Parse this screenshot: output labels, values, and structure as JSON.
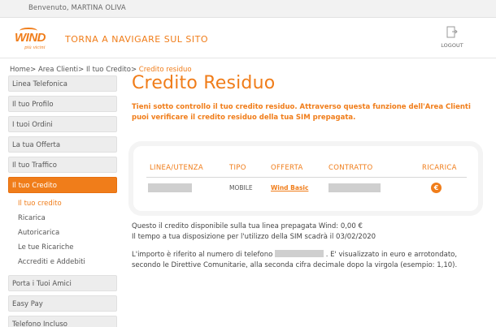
{
  "topbar": {
    "welcome": "Benvenuto, MARTINA OLIVA"
  },
  "header": {
    "logo_text": "WIND",
    "logo_tagline": "più vicini",
    "back_link": "TORNA A NAVIGARE SUL SITO",
    "logout_label": "LOGOUT"
  },
  "breadcrumb": {
    "home": "Home",
    "area": "Area Clienti",
    "credito": "Il tuo Credito",
    "current": "Credito residuo",
    "separator": ">"
  },
  "sidebar": {
    "items": [
      {
        "label": "Linea Telefonica"
      },
      {
        "label": "Il tuo Profilo"
      },
      {
        "label": "I tuoi Ordini"
      },
      {
        "label": "La tua Offerta"
      },
      {
        "label": "Il tuo Traffico"
      },
      {
        "label": "Il tuo Credito"
      },
      {
        "label": "Porta i Tuoi Amici"
      },
      {
        "label": "Easy Pay"
      },
      {
        "label": "Telefono Incluso"
      }
    ],
    "submenu": [
      {
        "label": "Il tuo credito"
      },
      {
        "label": "Ricarica"
      },
      {
        "label": "Autoricarica"
      },
      {
        "label": "Le tue Ricariche"
      },
      {
        "label": "Accrediti e Addebiti"
      }
    ]
  },
  "main": {
    "title": "Credito Residuo",
    "intro": "Tieni sotto controllo il tuo credito residuo. Attraverso questa funzione dell'Area Clienti puoi verificare il credito residuo della tua SIM prepagata.",
    "table": {
      "headers": [
        "LINEA/UTENZA",
        "TIPO",
        "OFFERTA",
        "CONTRATTO",
        "RICARICA"
      ],
      "row": {
        "tipo": "MOBILE",
        "offerta": "Wind Basic",
        "recharge_icon": "euro-icon"
      }
    },
    "info_line1": "Questo il credito disponibile sulla tua linea prepagata Wind: 0,00 €",
    "info_line2": "Il tempo a tua disposizione per l'utilizzo della SIM scadrà il 03/02/2020",
    "info_para_a": "L'importo è riferito al numero di telefono",
    "info_para_b": ". E' visualizzato in euro e arrotondato, secondo le Direttive Comunitarie, alla seconda cifra decimale dopo la virgola (esempio: 1,10)."
  },
  "colors": {
    "accent": "#f07d1a",
    "sidebar_bg": "#ededed",
    "redacted": "#cfcfcf"
  }
}
